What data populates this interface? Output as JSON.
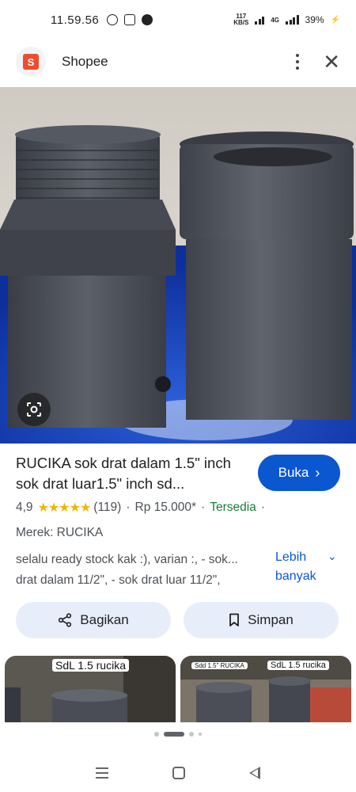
{
  "status_bar": {
    "time": "11.59.56",
    "net_speed_value": "117",
    "net_speed_unit": "KB/S",
    "network_type": "4G",
    "battery": "39%"
  },
  "header": {
    "app_name": "Shopee",
    "logo_letter": "S",
    "icons": [
      "shopee-logo-icon",
      "more-vert-icon",
      "close-icon"
    ]
  },
  "product": {
    "title": "RUCIKA sok drat dalam 1.5\" inch sok drat luar1.5\" inch sd...",
    "open_button": "Buka",
    "rating": "4,9",
    "stars": "★★★★★",
    "review_count": "(119)",
    "price": "Rp 15.000*",
    "availability": "Tersedia",
    "separator": "·",
    "brand": "Merek: RUCIKA",
    "description_line1": "selalu ready stock kak :), varian :, - sok...",
    "description_line2": "drat dalam 11/2\", - sok drat luar 11/2\",",
    "more_label_line1": "Lebih",
    "more_label_line2": "banyak"
  },
  "actions": {
    "share_label": "Bagikan",
    "save_label": "Simpan"
  },
  "thumbnails": [
    {
      "label": "SdL 1.5 rucika"
    },
    {
      "label_left": "Sdd 1.5\" RUCIKA",
      "label_right": "SdL 1.5 rucika"
    }
  ],
  "carousel": {
    "count": 5,
    "active_index": 1
  },
  "colors": {
    "accent": "#0b57d0",
    "shopee": "#ee4d2d",
    "stars": "#f4b400",
    "in_stock": "#188038",
    "pill_bg": "#e8eef9"
  }
}
